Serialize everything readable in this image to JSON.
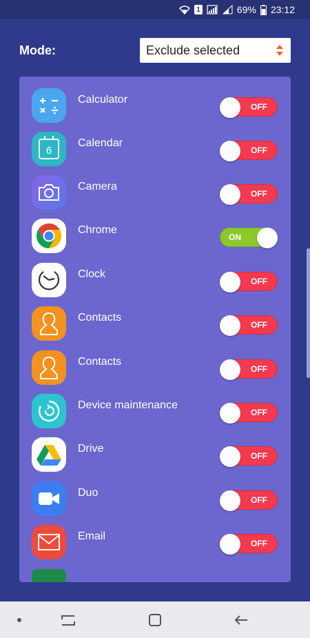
{
  "status": {
    "sim": "1",
    "battery": "69%",
    "time": "23:12"
  },
  "mode": {
    "label": "Mode:",
    "selected": "Exclude selected"
  },
  "apps": [
    {
      "name": "Calculator",
      "state": "OFF",
      "icon": "calculator-icon"
    },
    {
      "name": "Calendar",
      "state": "OFF",
      "icon": "calendar-icon",
      "icon_text": "6"
    },
    {
      "name": "Camera",
      "state": "OFF",
      "icon": "camera-icon"
    },
    {
      "name": "Chrome",
      "state": "ON",
      "icon": "chrome-icon"
    },
    {
      "name": "Clock",
      "state": "OFF",
      "icon": "clock-icon"
    },
    {
      "name": "Contacts",
      "state": "OFF",
      "icon": "contacts-icon"
    },
    {
      "name": "Contacts",
      "state": "OFF",
      "icon": "contacts-icon"
    },
    {
      "name": "Device maintenance",
      "state": "OFF",
      "icon": "device-maintenance-icon"
    },
    {
      "name": "Drive",
      "state": "OFF",
      "icon": "drive-icon"
    },
    {
      "name": "Duo",
      "state": "OFF",
      "icon": "duo-icon"
    },
    {
      "name": "Email",
      "state": "OFF",
      "icon": "email-icon"
    }
  ],
  "colors": {
    "background": "#2f3a8c",
    "panel": "#6b67cf",
    "toggle_off": "#f5394f",
    "toggle_on": "#8bc92a"
  },
  "nav": {
    "icons": [
      "dot-icon",
      "recents-icon",
      "home-icon",
      "back-icon"
    ]
  }
}
